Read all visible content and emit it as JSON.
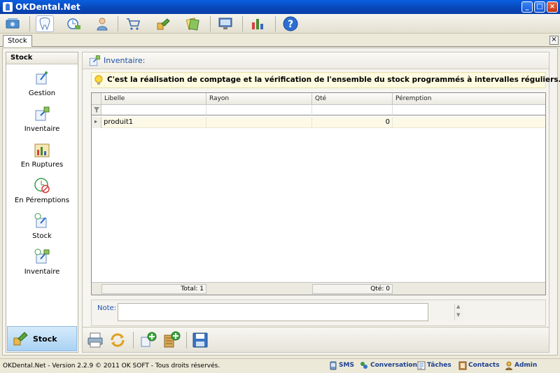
{
  "window": {
    "title": "OKDental.Net"
  },
  "tab": {
    "label": "Stock"
  },
  "left_panel": {
    "header": "Stock",
    "items": [
      {
        "label": "Gestion",
        "icon": "stock-manage-icon"
      },
      {
        "label": "Inventaire",
        "icon": "inventory-icon"
      },
      {
        "label": "En Ruptures",
        "icon": "chart-icon"
      },
      {
        "label": "En Péremptions",
        "icon": "expired-icon"
      },
      {
        "label": "Stock",
        "icon": "stock-icon"
      },
      {
        "label": "Inventaire",
        "icon": "inventory-icon"
      }
    ],
    "bottom": {
      "label": "Stock"
    }
  },
  "content": {
    "title": "Inventaire:",
    "hint": "C'est la réalisation de comptage et la vérification de l'ensemble du stock programmés à intervalles réguliers.",
    "grid": {
      "columns": [
        "Libelle",
        "Rayon",
        "Qté",
        "Péremption"
      ],
      "rows": [
        {
          "libelle": "produit1",
          "rayon": "",
          "qte": "0",
          "peremption": ""
        }
      ],
      "footer": {
        "total": "Total: 1",
        "qte": "Qté: 0"
      }
    },
    "note": {
      "label": "Note:",
      "value": ""
    }
  },
  "status": {
    "copyright": "OKDental.Net - Version 2.2.9 © 2011 OK SOFT - Tous droits réservés.",
    "sms": "SMS",
    "conversation": "Conversation",
    "taches": "Tâches",
    "contacts": "Contacts",
    "admin": "Admin"
  },
  "colors": {
    "title_blue": "#0846b8",
    "link_blue": "#1d4fa8",
    "hint_bg": "#fffbe0"
  }
}
